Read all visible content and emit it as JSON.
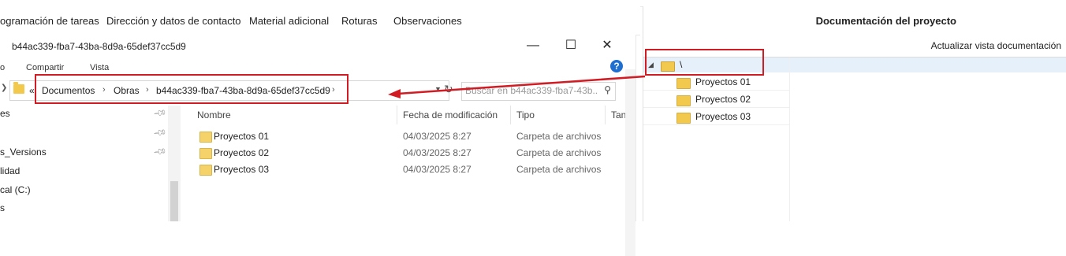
{
  "top_tabs": [
    "ogramación de tareas",
    "Dirección y datos de contacto",
    "Material adicional",
    "Roturas",
    "Observaciones"
  ],
  "explorer": {
    "window_title": "b44ac339-fba7-43ba-8d9a-65def37cc5d9",
    "window_buttons": {
      "minimize": "—",
      "maximize": "☐",
      "close": "✕"
    },
    "ribbon": [
      "o",
      "Compartir",
      "Vista"
    ],
    "help_glyph": "?",
    "address": {
      "overflow": "«",
      "crumbs": [
        "Documentos",
        "Obras",
        "b44ac339-fba7-43ba-8d9a-65def37cc5d9"
      ],
      "separator": "›"
    },
    "search_placeholder": "Buscar en b44ac339-fba7-43b...",
    "nav_items": [
      "es",
      "s_Versions",
      "lidad",
      "cal (C:)",
      "s"
    ],
    "columns": {
      "name": "Nombre",
      "date": "Fecha de modificación",
      "type": "Tipo",
      "size": "Tan"
    },
    "files": [
      {
        "name": "Proyectos 01",
        "date": "04/03/2025 8:27",
        "type": "Carpeta de archivos"
      },
      {
        "name": "Proyectos 02",
        "date": "04/03/2025 8:27",
        "type": "Carpeta de archivos"
      },
      {
        "name": "Proyectos 03",
        "date": "04/03/2025 8:27",
        "type": "Carpeta de archivos"
      }
    ]
  },
  "doc_panel": {
    "title": "Documentación del proyecto",
    "refresh_button": "Actualizar vista documentación",
    "root_label": "\\",
    "expander": "◢",
    "tree_items": [
      "Proyectos 01",
      "Proyectos 02",
      "Proyectos 03"
    ]
  },
  "colors": {
    "annotation_red": "#d11c24",
    "selection_blue": "#e6f0fb",
    "folder_yellow": "#f2c94c",
    "help_blue": "#1e6fd0"
  }
}
